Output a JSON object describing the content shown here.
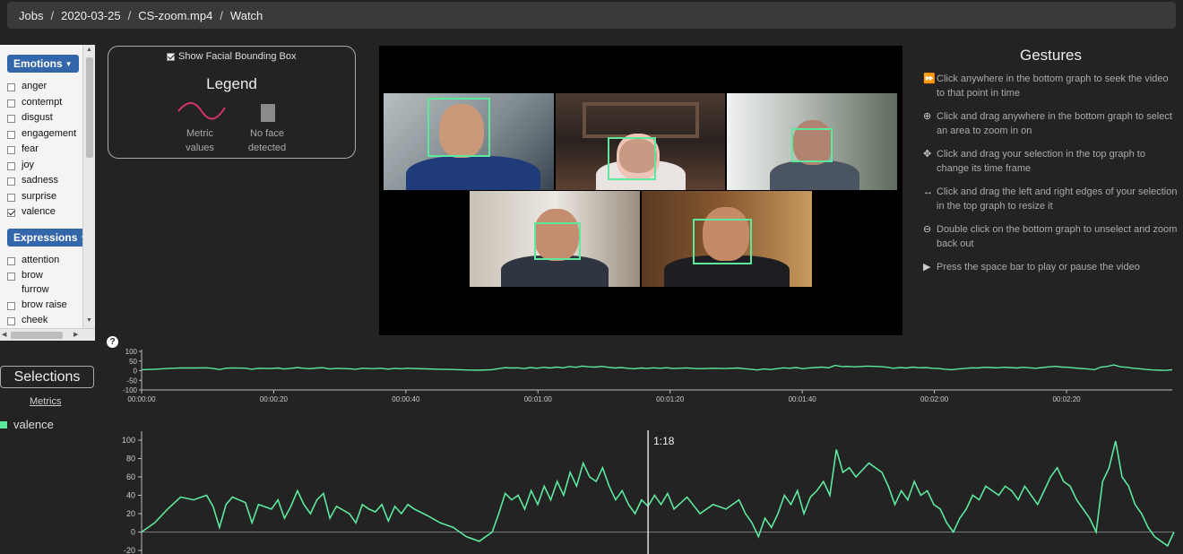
{
  "breadcrumb": [
    "Jobs",
    "2020-03-25",
    "CS-zoom.mp4",
    "Watch"
  ],
  "sidebar": {
    "emotions_label": "Emotions",
    "emotions": [
      {
        "label": "anger",
        "checked": false
      },
      {
        "label": "contempt",
        "checked": false
      },
      {
        "label": "disgust",
        "checked": false
      },
      {
        "label": "engagement",
        "checked": false
      },
      {
        "label": "fear",
        "checked": false
      },
      {
        "label": "joy",
        "checked": false
      },
      {
        "label": "sadness",
        "checked": false
      },
      {
        "label": "surprise",
        "checked": false
      },
      {
        "label": "valence",
        "checked": true
      }
    ],
    "expressions_label": "Expressions",
    "expressions": [
      {
        "label": "attention",
        "checked": false
      },
      {
        "label": "brow furrow",
        "checked": false
      },
      {
        "label": "brow raise",
        "checked": false
      },
      {
        "label": "cheek",
        "checked": false
      }
    ]
  },
  "legend": {
    "toggle_label": "Show Facial Bounding Box",
    "toggle_checked": true,
    "title": "Legend",
    "metric_label_1": "Metric",
    "metric_label_2": "values",
    "noface_label_1": "No face",
    "noface_label_2": "detected"
  },
  "gestures": {
    "title": "Gestures",
    "items": [
      {
        "icon": "fast-forward-icon",
        "glyph": "⏩",
        "text": "Click anywhere in the bottom graph to seek the video to that point in time"
      },
      {
        "icon": "zoom-in-icon",
        "glyph": "⊕",
        "text": "Click and drag anywhere in the bottom graph to select an area to zoom in on"
      },
      {
        "icon": "move-icon",
        "glyph": "✥",
        "text": "Click and drag your selection in the top graph to change its time frame"
      },
      {
        "icon": "resize-horizontal-icon",
        "glyph": "↔",
        "text": "Click and drag the left and right edges of your selection in the top graph to resize it"
      },
      {
        "icon": "zoom-out-icon",
        "glyph": "⊖",
        "text": "Double click on the bottom graph to unselect and zoom back out"
      },
      {
        "icon": "play-icon",
        "glyph": "▶",
        "text": "Press the space bar to play or pause the video"
      }
    ]
  },
  "selections": {
    "button_label": "Selections",
    "metrics_label": "Metrics",
    "metric_name": "valence",
    "metric_color": "#5de89e"
  },
  "help_glyph": "?",
  "chart_data": [
    {
      "type": "line",
      "ylim": [
        -100,
        100
      ],
      "yticks": [
        100,
        50,
        0,
        -50,
        -100
      ],
      "xlim_seconds": [
        0,
        156
      ],
      "xticks": [
        {
          "t": 0,
          "label": "00:00:00"
        },
        {
          "t": 20,
          "label": "00:00:20"
        },
        {
          "t": 40,
          "label": "00:00:40"
        },
        {
          "t": 60,
          "label": "00:01:00"
        },
        {
          "t": 80,
          "label": "00:01:20"
        },
        {
          "t": 100,
          "label": "00:01:40"
        },
        {
          "t": 120,
          "label": "00:02:00"
        },
        {
          "t": 140,
          "label": "00:02:20"
        }
      ],
      "series": [
        {
          "name": "valence",
          "color": "#5de89e"
        }
      ]
    },
    {
      "type": "line",
      "ylim": [
        -20,
        100
      ],
      "yticks": [
        100,
        80,
        60,
        40,
        20,
        0,
        -20
      ],
      "cursor_label": "1:18",
      "cursor_t": 78,
      "series": [
        {
          "name": "valence",
          "color": "#5de89e",
          "points": [
            [
              0,
              0
            ],
            [
              2,
              10
            ],
            [
              4,
              25
            ],
            [
              6,
              38
            ],
            [
              8,
              35
            ],
            [
              10,
              40
            ],
            [
              11,
              28
            ],
            [
              12,
              5
            ],
            [
              13,
              30
            ],
            [
              14,
              38
            ],
            [
              16,
              32
            ],
            [
              17,
              10
            ],
            [
              18,
              30
            ],
            [
              20,
              25
            ],
            [
              21,
              35
            ],
            [
              22,
              15
            ],
            [
              23,
              28
            ],
            [
              24,
              45
            ],
            [
              25,
              30
            ],
            [
              26,
              20
            ],
            [
              27,
              35
            ],
            [
              28,
              42
            ],
            [
              29,
              15
            ],
            [
              30,
              28
            ],
            [
              32,
              20
            ],
            [
              33,
              10
            ],
            [
              34,
              30
            ],
            [
              35,
              25
            ],
            [
              36,
              22
            ],
            [
              37,
              30
            ],
            [
              38,
              12
            ],
            [
              39,
              28
            ],
            [
              40,
              20
            ],
            [
              41,
              30
            ],
            [
              42,
              25
            ],
            [
              44,
              18
            ],
            [
              46,
              10
            ],
            [
              48,
              5
            ],
            [
              50,
              -5
            ],
            [
              52,
              -10
            ],
            [
              54,
              0
            ],
            [
              55,
              20
            ],
            [
              56,
              42
            ],
            [
              57,
              35
            ],
            [
              58,
              40
            ],
            [
              59,
              25
            ],
            [
              60,
              45
            ],
            [
              61,
              30
            ],
            [
              62,
              50
            ],
            [
              63,
              35
            ],
            [
              64,
              55
            ],
            [
              65,
              40
            ],
            [
              66,
              65
            ],
            [
              67,
              50
            ],
            [
              68,
              75
            ],
            [
              69,
              60
            ],
            [
              70,
              55
            ],
            [
              71,
              70
            ],
            [
              72,
              50
            ],
            [
              73,
              35
            ],
            [
              74,
              45
            ],
            [
              75,
              30
            ],
            [
              76,
              20
            ],
            [
              77,
              35
            ],
            [
              78,
              28
            ],
            [
              79,
              40
            ],
            [
              80,
              30
            ],
            [
              81,
              42
            ],
            [
              82,
              25
            ],
            [
              84,
              38
            ],
            [
              86,
              20
            ],
            [
              88,
              30
            ],
            [
              90,
              25
            ],
            [
              92,
              35
            ],
            [
              93,
              20
            ],
            [
              94,
              10
            ],
            [
              95,
              -5
            ],
            [
              96,
              15
            ],
            [
              97,
              5
            ],
            [
              98,
              20
            ],
            [
              99,
              40
            ],
            [
              100,
              30
            ],
            [
              101,
              45
            ],
            [
              102,
              20
            ],
            [
              103,
              38
            ],
            [
              104,
              45
            ],
            [
              105,
              55
            ],
            [
              106,
              40
            ],
            [
              107,
              90
            ],
            [
              108,
              65
            ],
            [
              109,
              70
            ],
            [
              110,
              60
            ],
            [
              112,
              75
            ],
            [
              114,
              65
            ],
            [
              115,
              50
            ],
            [
              116,
              30
            ],
            [
              117,
              45
            ],
            [
              118,
              35
            ],
            [
              119,
              55
            ],
            [
              120,
              40
            ],
            [
              121,
              45
            ],
            [
              122,
              30
            ],
            [
              123,
              25
            ],
            [
              124,
              10
            ],
            [
              125,
              0
            ],
            [
              126,
              15
            ],
            [
              127,
              25
            ],
            [
              128,
              40
            ],
            [
              129,
              35
            ],
            [
              130,
              50
            ],
            [
              131,
              45
            ],
            [
              132,
              40
            ],
            [
              133,
              50
            ],
            [
              134,
              45
            ],
            [
              135,
              35
            ],
            [
              136,
              50
            ],
            [
              137,
              40
            ],
            [
              138,
              30
            ],
            [
              139,
              45
            ],
            [
              140,
              60
            ],
            [
              141,
              70
            ],
            [
              142,
              55
            ],
            [
              143,
              50
            ],
            [
              144,
              35
            ],
            [
              145,
              25
            ],
            [
              146,
              15
            ],
            [
              147,
              0
            ],
            [
              148,
              55
            ],
            [
              149,
              70
            ],
            [
              150,
              99
            ],
            [
              151,
              60
            ],
            [
              152,
              50
            ],
            [
              153,
              30
            ],
            [
              154,
              20
            ],
            [
              155,
              5
            ],
            [
              156,
              -5
            ],
            [
              157,
              -10
            ],
            [
              158,
              -15
            ],
            [
              159,
              0
            ]
          ]
        }
      ]
    }
  ]
}
